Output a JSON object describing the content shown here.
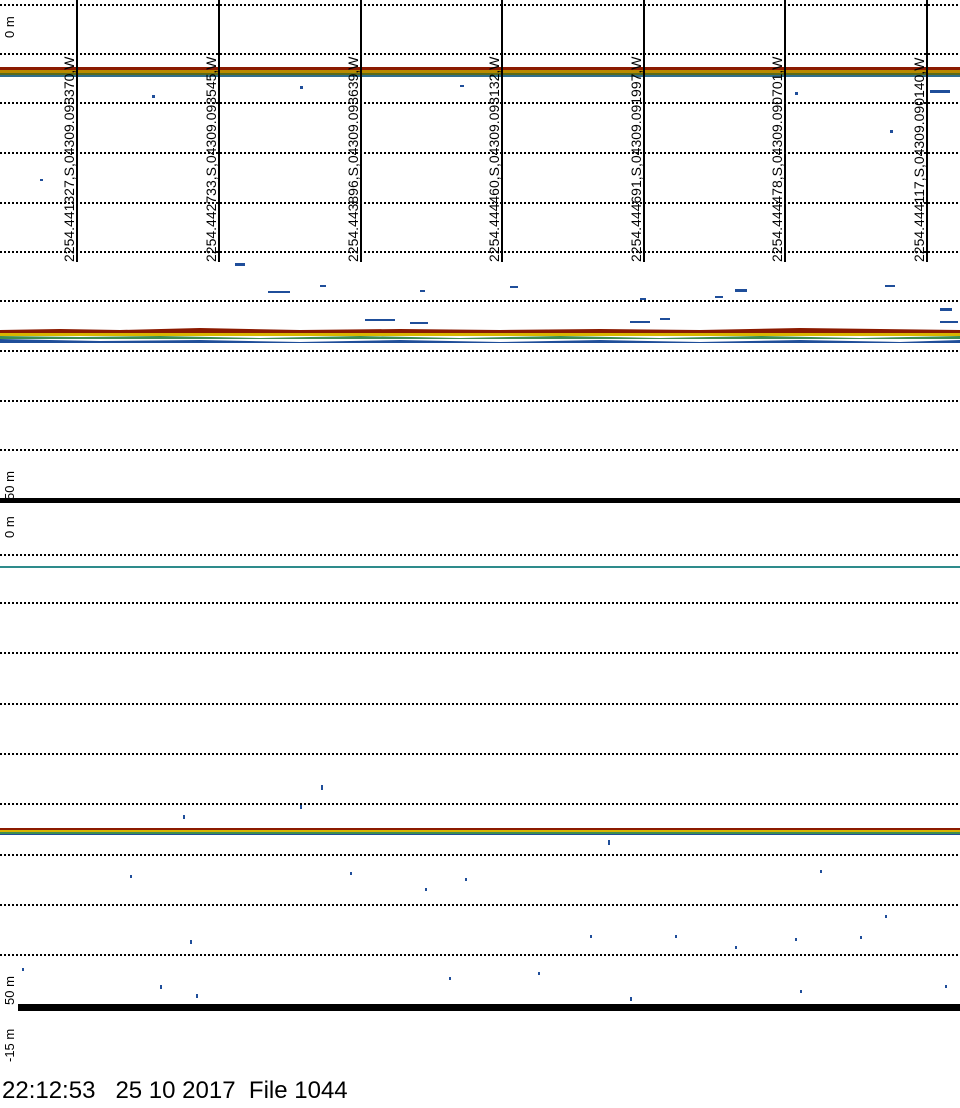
{
  "panel_top": {
    "depth_labels": [
      "0 m",
      "50 m"
    ],
    "positions": [
      "2254.441327,S,04309.093370,W",
      "2254.442733,S,04309.093545,W",
      "2254.443896,S,04309.093639,W",
      "2254.444460,S,04309.093132,W",
      "2254.444691,S,04309.091997,W",
      "2254.444478,S,04309.090701,W",
      "2254.444117,S,04309.090140,W"
    ]
  },
  "panel_bottom": {
    "depth_labels": [
      "0 m",
      "50 m",
      "-15 m"
    ]
  },
  "footer": {
    "time": "22:12:53",
    "date": "25 10 2017",
    "file": "File 1044"
  },
  "colors": {
    "grid": "#000000",
    "echo_strong": "#8b1a00",
    "echo_mid": "#d9b400",
    "echo_weak": "#1f4e9a",
    "echo_faint": "#2e8b8b"
  }
}
